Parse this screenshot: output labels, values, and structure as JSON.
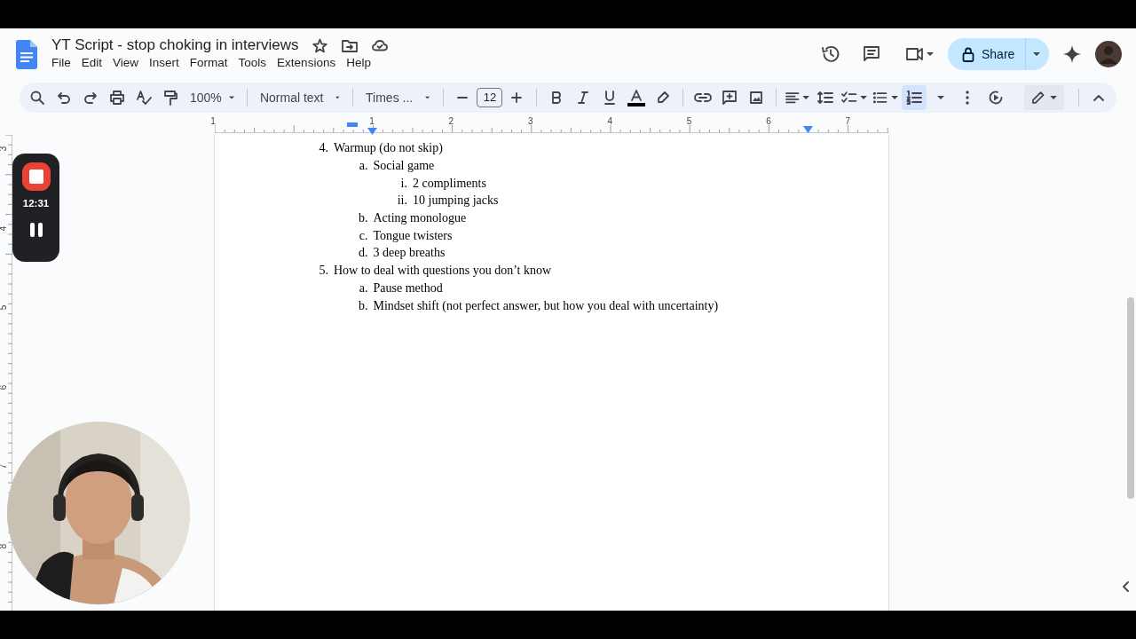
{
  "document": {
    "title": "YT Script - stop choking in interviews"
  },
  "menu": [
    "File",
    "Edit",
    "View",
    "Insert",
    "Format",
    "Tools",
    "Extensions",
    "Help"
  ],
  "share": {
    "label": "Share"
  },
  "toolbar": {
    "zoom": "100%",
    "style": "Normal text",
    "font": "Times ...",
    "font_size": "12",
    "numbered_list_selected": true
  },
  "ruler": {
    "labels": [
      "1",
      "1",
      "2",
      "3",
      "4",
      "5",
      "6",
      "7"
    ]
  },
  "vertical_ruler": {
    "labels": [
      "3",
      "4",
      "5",
      "6",
      "7",
      "8"
    ]
  },
  "outline": [
    {
      "marker": "4.",
      "text": "Warmup (do not skip)",
      "children": [
        {
          "marker": "a.",
          "text": "Social game",
          "children": [
            {
              "marker": "i.",
              "text": "2 compliments"
            },
            {
              "marker": "ii.",
              "text": "10 jumping jacks"
            }
          ]
        },
        {
          "marker": "b.",
          "text": "Acting monologue"
        },
        {
          "marker": "c.",
          "text": "Tongue twisters"
        },
        {
          "marker": "d.",
          "text": "3 deep breaths"
        }
      ]
    },
    {
      "marker": "5.",
      "text": "How to deal with questions you don’t know",
      "children": [
        {
          "marker": "a.",
          "text": "Pause method"
        },
        {
          "marker": "b.",
          "text": "Mindset shift (not perfect answer, but how you deal with uncertainty)"
        }
      ]
    }
  ],
  "recorder": {
    "time": "12:31"
  }
}
